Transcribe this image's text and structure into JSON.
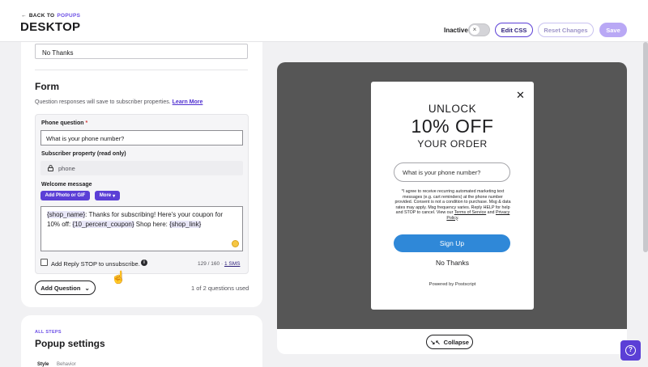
{
  "header": {
    "back_prefix": "BACK TO",
    "back_target": "POPUPS",
    "title": "DESKTOP",
    "status": "Inactive",
    "edit_css": "Edit CSS",
    "reset": "Reset Changes",
    "save": "Save"
  },
  "editor": {
    "no_thanks_value": "No Thanks",
    "form_title": "Form",
    "form_desc": "Question responses will save to subscriber properties.",
    "learn_more": "Learn More",
    "phone_question_label": "Phone question",
    "phone_question_value": "What is your phone number?",
    "subscriber_property_label": "Subscriber property (read only)",
    "subscriber_property_value": "phone",
    "welcome_label": "Welcome message",
    "add_media": "Add Photo or GIF",
    "more": "More",
    "message": {
      "tok_shop_name": "{shop_name}",
      "text1": ": Thanks for subscribing! Here's your coupon for 10% off: ",
      "tok_coupon": "{10_percent_coupon}",
      "text2": " Shop here: ",
      "tok_link": "{shop_link}"
    },
    "reply_stop_label": "Add Reply STOP to unsubscribe.",
    "char_count": "129",
    "char_max": "/ 160",
    "sms_sep": "·",
    "sms_count": "1 SMS",
    "add_question": "Add Question",
    "questions_used": "1 of 2 questions used"
  },
  "settings": {
    "eyebrow": "ALL STEPS",
    "title": "Popup settings",
    "tabs": [
      "Style",
      "Behavior"
    ]
  },
  "preview": {
    "headline1": "UNLOCK",
    "headline2": "10% OFF",
    "headline3": "YOUR ORDER",
    "input_placeholder": "What is your phone number?",
    "disclaimer_main": "*I agree to receive recurring automated marketing text messages (e.g. cart reminders) at the phone number provided. Consent is not a condition to purchase. Msg & data rates may apply. Msg frequency varies. Reply HELP for help and STOP to cancel. View our ",
    "terms": "Terms of Service",
    "and": " and ",
    "privacy": "Privacy Policy",
    "period": ".",
    "signup": "Sign Up",
    "no_thanks": "No Thanks",
    "powered": "Powered by Postscript",
    "collapse": "Collapse"
  },
  "colors": {
    "accent": "#5b3fd6",
    "signup": "#2f88d8",
    "preview_bg": "#565656"
  },
  "icons": [
    "arrow-left-icon",
    "close-icon",
    "lock-icon",
    "chevron-down-icon",
    "info-icon",
    "emoji-icon",
    "collapse-icon",
    "help-icon",
    "pointer-cursor-icon"
  ]
}
